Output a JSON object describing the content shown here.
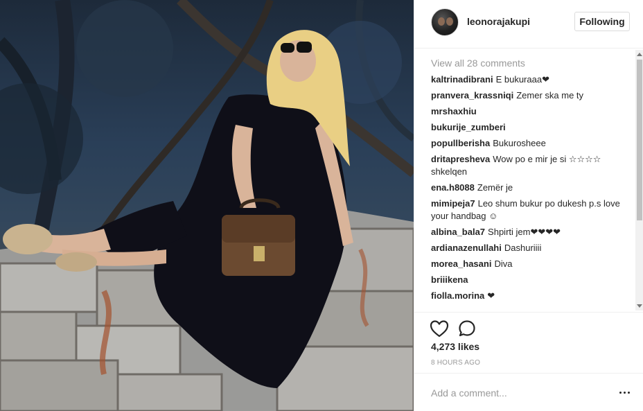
{
  "post": {
    "username": "leonorajakupi",
    "follow_label": "Following",
    "view_all_label": "View all 28 comments",
    "likes": "4,273 likes",
    "time": "8 HOURS AGO",
    "add_comment_placeholder": "Add a comment..."
  },
  "comments": [
    {
      "author": "kaltrinadibrani",
      "text": "E bukuraaa❤"
    },
    {
      "author": "pranvera_krassniqi",
      "text": "Zemer ska me ty"
    },
    {
      "author": "mrshaxhiu",
      "text": ""
    },
    {
      "author": "bukurije_zumberi",
      "text": ""
    },
    {
      "author": "popullberisha",
      "text": "Bukurosheee"
    },
    {
      "author": "dritapresheva",
      "text": "Wow po e mir je si ☆☆☆☆ shkelqen"
    },
    {
      "author": "ena.h8088",
      "text": "Zemër je"
    },
    {
      "author": "mimipeja7",
      "text": "Leo shum bukur po dukesh p.s love your handbag ☺"
    },
    {
      "author": "albina_bala7",
      "text": "Shpirti jem❤❤❤❤"
    },
    {
      "author": "ardianazenullahi",
      "text": "Dashuriiii"
    },
    {
      "author": "morea_hasani",
      "text": "Diva"
    },
    {
      "author": "briiikena",
      "text": ""
    },
    {
      "author": "fiolla.morina",
      "text": "❤"
    }
  ],
  "icons": {
    "like": "heart-icon",
    "comment": "comment-icon",
    "more": "more-options-icon"
  }
}
